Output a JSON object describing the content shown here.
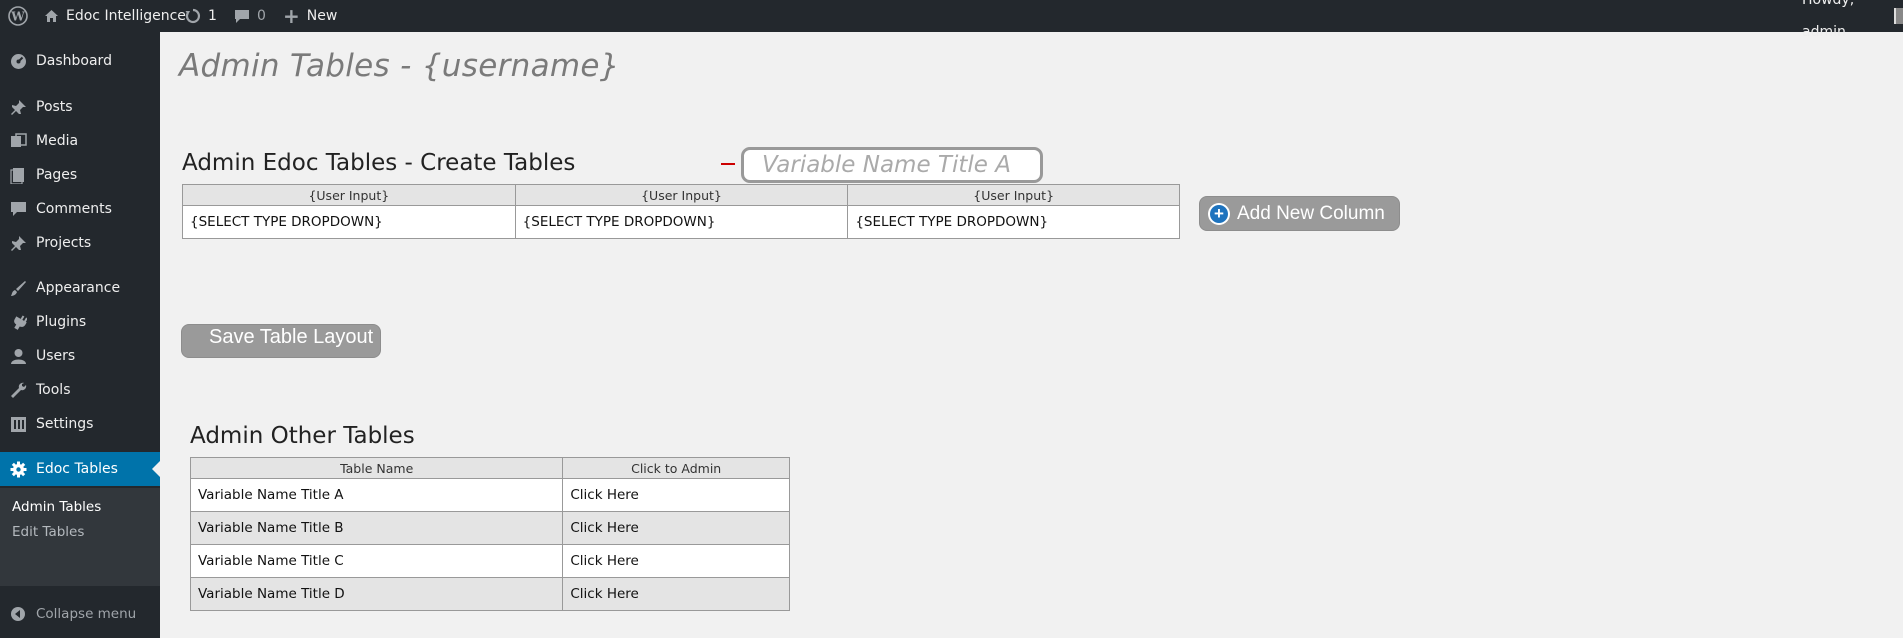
{
  "adminbar": {
    "site_name": "Edoc Intelligence",
    "updates_count": "1",
    "comments_count": "0",
    "new_label": "New",
    "greeting": "Howdy, admin"
  },
  "sidebar": {
    "items": [
      {
        "label": "Dashboard",
        "icon": "dashboard-icon"
      },
      {
        "label": "Posts",
        "icon": "pin-icon"
      },
      {
        "label": "Media",
        "icon": "media-icon"
      },
      {
        "label": "Pages",
        "icon": "pages-icon"
      },
      {
        "label": "Comments",
        "icon": "comment-icon"
      },
      {
        "label": "Projects",
        "icon": "pin-icon"
      },
      {
        "label": "Appearance",
        "icon": "paintbrush-icon"
      },
      {
        "label": "Plugins",
        "icon": "plugin-icon"
      },
      {
        "label": "Users",
        "icon": "user-icon"
      },
      {
        "label": "Tools",
        "icon": "wrench-icon"
      },
      {
        "label": "Settings",
        "icon": "settings-icon"
      },
      {
        "label": "Edoc Tables",
        "icon": "gear-icon"
      }
    ],
    "submenu": [
      "Admin Tables",
      "Edit Tables"
    ],
    "collapse_label": "Collapse menu",
    "accent_color": "#0073aa"
  },
  "main": {
    "page_title": "Admin Tables - {username}",
    "create_title": "Admin Edoc Tables - Create Tables",
    "name_placeholder": "Variable Name Title A",
    "create_table": {
      "headers": [
        "{User Input}",
        "{User Input}",
        "{User Input}"
      ],
      "row": [
        "{SELECT TYPE DROPDOWN}",
        "{SELECT TYPE DROPDOWN}",
        "{SELECT TYPE DROPDOWN}"
      ]
    },
    "add_column_label": "Add New Column",
    "save_label": "Save Table Layout",
    "other_title": "Admin Other Tables",
    "other_table": {
      "headers": [
        "Table Name",
        "Click to Admin"
      ],
      "rows": [
        [
          "Variable Name Title A",
          "Click Here"
        ],
        [
          "Variable Name Title B",
          "Click Here"
        ],
        [
          "Variable Name Title C",
          "Click Here"
        ],
        [
          "Variable Name Title D",
          "Click Here"
        ]
      ]
    }
  }
}
